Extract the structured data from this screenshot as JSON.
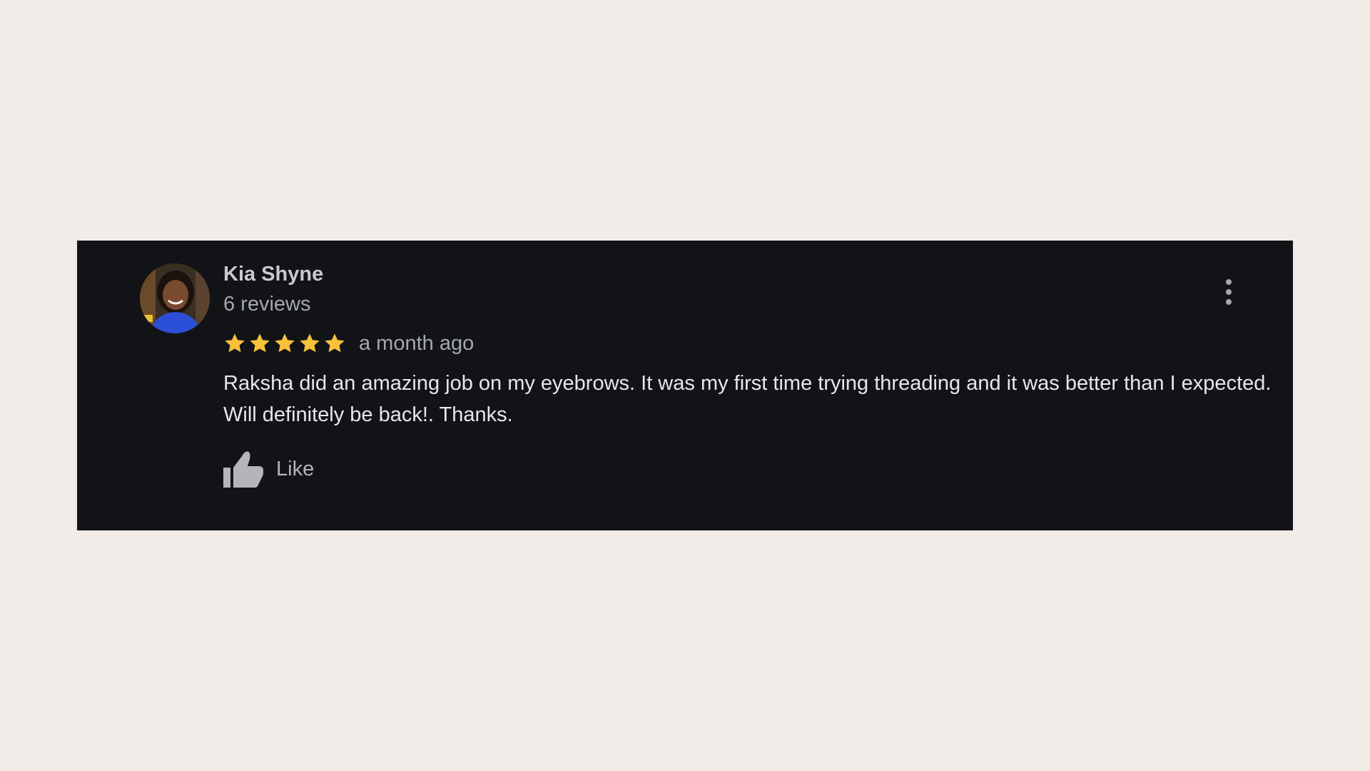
{
  "review": {
    "author_name": "Kia Shyne",
    "review_count": "6 reviews",
    "rating": 5,
    "rating_max": 5,
    "time_ago": "a month ago",
    "text": "Raksha did an amazing job on my eyebrows. It was my first time trying threading and it was better than I expected. Will definitely be back!. Thanks.",
    "like_label": "Like",
    "more_icon": "more-vertical-icon",
    "like_icon": "thumbs-up-icon",
    "star_icon": "star-icon"
  },
  "colors": {
    "page_background": "#f1ece7",
    "card_background": "#121317",
    "star": "#f8c13a",
    "name_text": "#c9cace",
    "muted_text": "#a4a7ae",
    "body_text": "#e6e7ea"
  }
}
